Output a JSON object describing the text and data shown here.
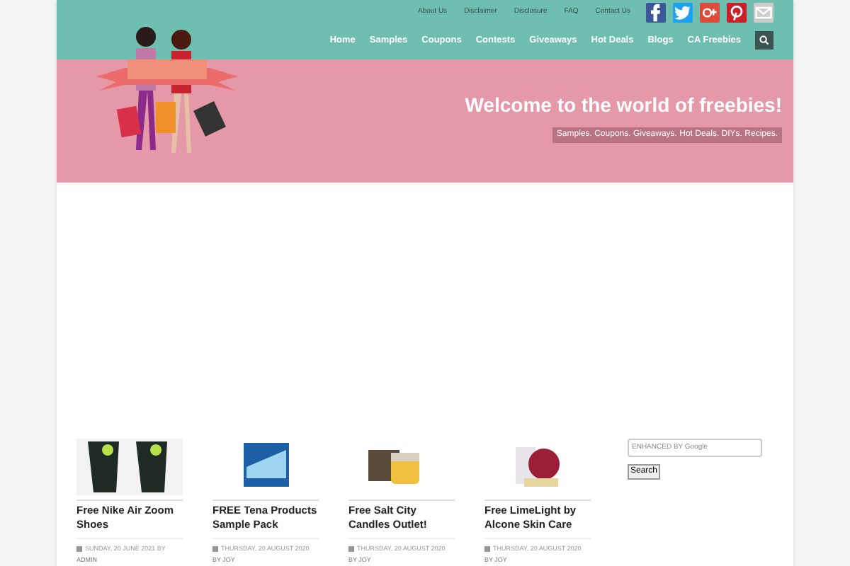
{
  "top_links": [
    "About Us",
    "Disclaimer",
    "Disclosure",
    "FAQ",
    "Contact Us"
  ],
  "social": [
    {
      "kind": "facebook",
      "color": "#3b5998"
    },
    {
      "kind": "twitter",
      "color": "#1da1f2"
    },
    {
      "kind": "googleplus",
      "color": "#dd4b39"
    },
    {
      "kind": "pinterest",
      "color": "#cb2027"
    },
    {
      "kind": "email",
      "color": "#cccccc"
    }
  ],
  "nav": [
    "Home",
    "Samples",
    "Coupons",
    "Contests",
    "Giveaways",
    "Hot Deals",
    "Blogs",
    "CA Freebies"
  ],
  "banner": {
    "title": "Welcome to the world of freebies!",
    "tagline": "Samples. Coupons. Giveaways. Hot Deals. DIYs. Recipes."
  },
  "posts": [
    {
      "title": "Free Nike Air Zoom Shoes",
      "date": "SUNDAY, 20 JUNE 2021 BY",
      "author": "ADMIN",
      "kind": "shoes"
    },
    {
      "title": "FREE Tena Products Sample Pack",
      "date": "THURSDAY, 20 AUGUST 2020",
      "author": "BY JOY",
      "kind": "package"
    },
    {
      "title": "Free Salt City Candles Outlet!",
      "date": "THURSDAY, 20 AUGUST 2020",
      "author": "BY JOY",
      "kind": "candle"
    },
    {
      "title": "Free LimeLight by Alcone Skin Care",
      "date": "THURSDAY, 20 AUGUST 2020",
      "author": "BY JOY",
      "kind": "skincare"
    }
  ],
  "search": {
    "placeholder": "ENHANCED BY Google",
    "button": "Search"
  }
}
